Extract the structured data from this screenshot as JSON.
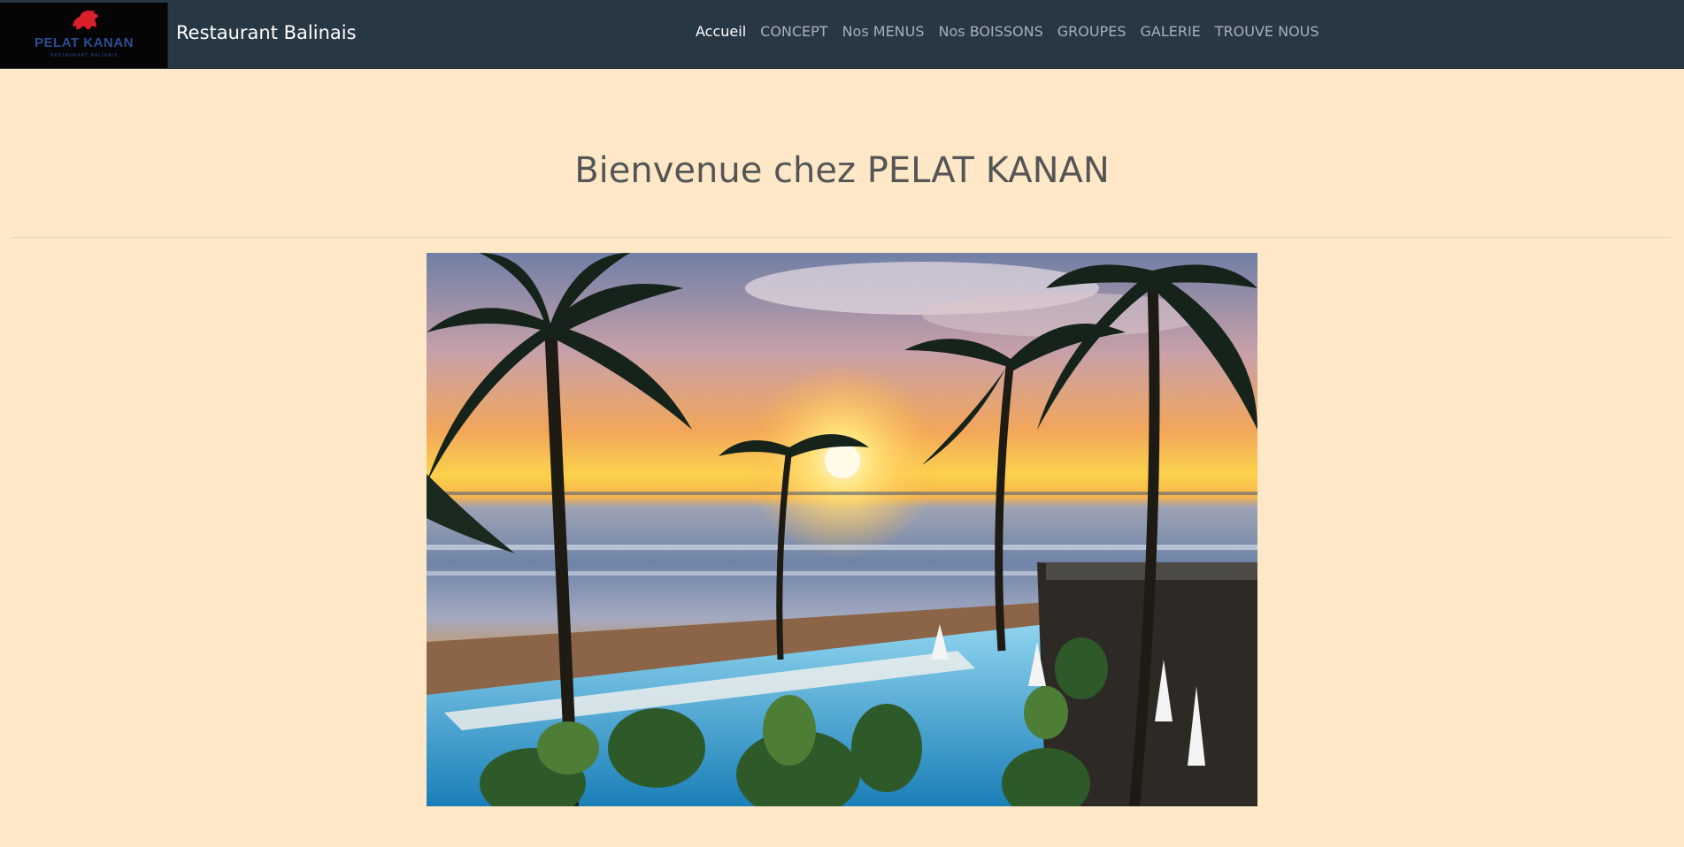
{
  "navbar": {
    "logo": {
      "name": "PELAT KANAN",
      "subtitle": "RESTAURANT BALINAIS",
      "icon": "lion-icon",
      "icon_color": "#d9202b",
      "text_color": "#2f4c93"
    },
    "brand": "Restaurant Balinais",
    "links": [
      {
        "label": "Accueil",
        "active": true
      },
      {
        "label": "CONCEPT",
        "active": false
      },
      {
        "label": "Nos MENUS",
        "active": false
      },
      {
        "label": "Nos BOISSONS",
        "active": false
      },
      {
        "label": "GROUPES",
        "active": false
      },
      {
        "label": "GALERIE",
        "active": false
      },
      {
        "label": "TROUVE NOUS",
        "active": false
      }
    ],
    "background": "#283744"
  },
  "main": {
    "title": "Bienvenue chez PELAT KANAN",
    "background": "#ffe8c8"
  }
}
